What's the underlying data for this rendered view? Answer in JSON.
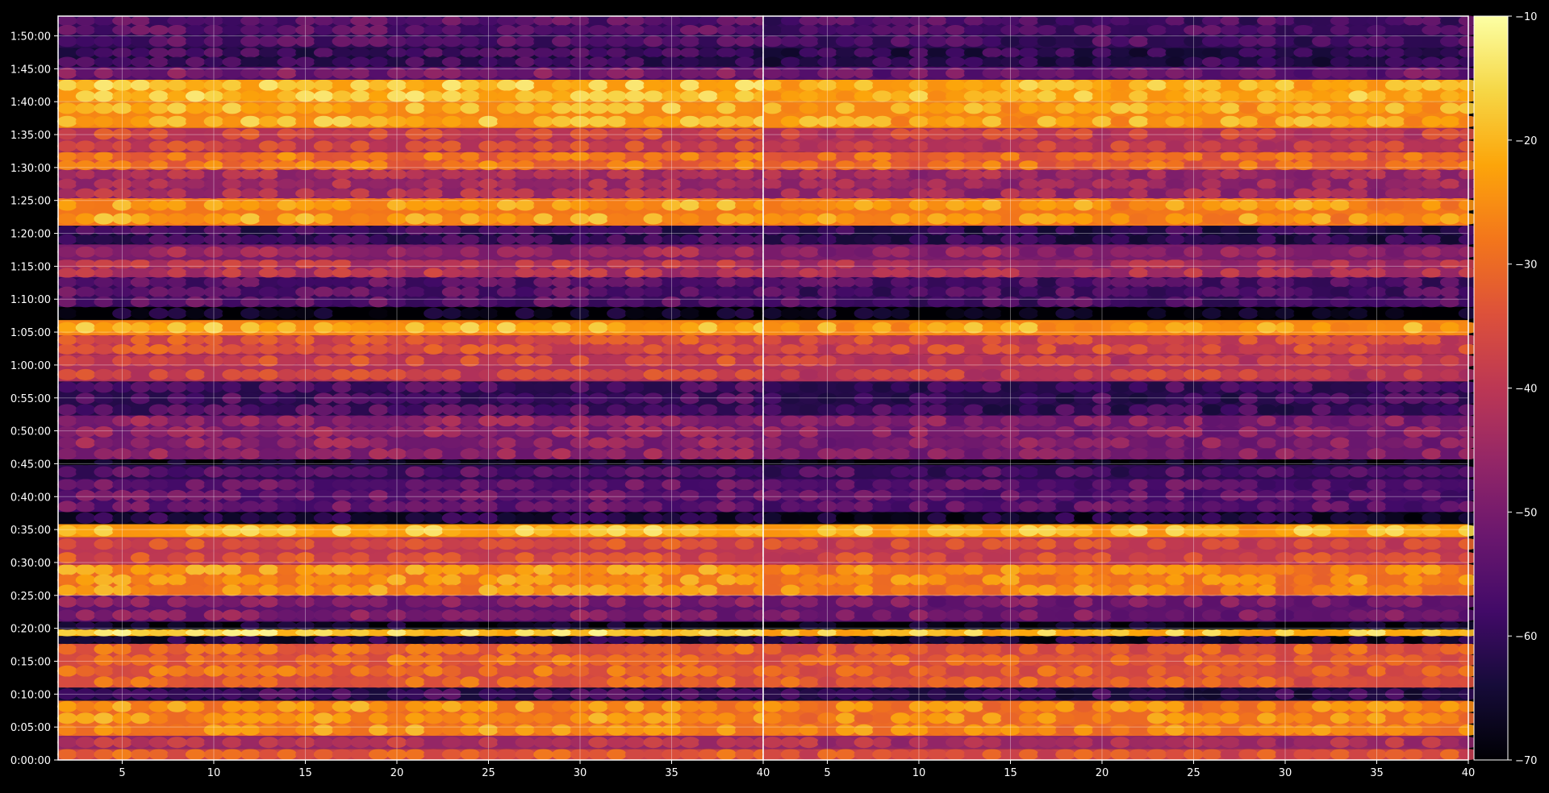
{
  "chart_data": {
    "type": "heatmap",
    "title": "",
    "xlabel": "",
    "ylabel": "",
    "panels": [
      {
        "name": "",
        "xlim": [
          1.5,
          40
        ]
      },
      {
        "name": "",
        "xlim": [
          1.5,
          40
        ]
      }
    ],
    "x_ticks": [
      5,
      10,
      15,
      20,
      25,
      30,
      35,
      40
    ],
    "x_tick_labels": [
      "5",
      "10",
      "15",
      "20",
      "25",
      "30",
      "35",
      "40"
    ],
    "y_range_seconds": [
      0,
      6780
    ],
    "y_ticks_seconds": [
      0,
      300,
      600,
      900,
      1200,
      1500,
      1800,
      2100,
      2400,
      2700,
      3000,
      3300,
      3600,
      3900,
      4200,
      4500,
      4800,
      5100,
      5400,
      5700,
      6000,
      6300,
      6600
    ],
    "y_tick_labels": [
      "0:00:00",
      "0:05:00",
      "0:10:00",
      "0:15:00",
      "0:20:00",
      "0:25:00",
      "0:30:00",
      "0:35:00",
      "0:40:00",
      "0:45:00",
      "0:50:00",
      "0:55:00",
      "1:00:00",
      "1:05:00",
      "1:10:00",
      "1:15:00",
      "1:20:00",
      "1:25:00",
      "1:30:00",
      "1:35:00",
      "1:40:00",
      "1:45:00",
      "1:50:00"
    ],
    "colorbar": {
      "colormap": "inferno",
      "range": [
        -70,
        -10
      ],
      "ticks": [
        -10,
        -20,
        -30,
        -40,
        -50,
        -60,
        -70
      ],
      "tick_labels": [
        "−10",
        "−20",
        "−30",
        "−40",
        "−50",
        "−60",
        "−70"
      ]
    },
    "grid": true,
    "row_bands": [
      {
        "y_range": [
          0,
          100
        ],
        "level": -32
      },
      {
        "y_range": [
          100,
          220
        ],
        "level": -40
      },
      {
        "y_range": [
          220,
          540
        ],
        "level": -24
      },
      {
        "y_range": [
          540,
          660
        ],
        "level": -58
      },
      {
        "y_range": [
          660,
          1060
        ],
        "level": -30
      },
      {
        "y_range": [
          1060,
          1130
        ],
        "level": -62
      },
      {
        "y_range": [
          1130,
          1190
        ],
        "level": -16
      },
      {
        "y_range": [
          1190,
          1260
        ],
        "level": -66
      },
      {
        "y_range": [
          1260,
          1500
        ],
        "level": -48
      },
      {
        "y_range": [
          1500,
          1780
        ],
        "level": -24
      },
      {
        "y_range": [
          1780,
          2030
        ],
        "level": -34
      },
      {
        "y_range": [
          2030,
          2150
        ],
        "level": -18
      },
      {
        "y_range": [
          2150,
          2260
        ],
        "level": -62
      },
      {
        "y_range": [
          2260,
          2560
        ],
        "level": -52
      },
      {
        "y_range": [
          2560,
          2690
        ],
        "level": -55
      },
      {
        "y_range": [
          2690,
          2740
        ],
        "level": -68
      },
      {
        "y_range": [
          2740,
          3140
        ],
        "level": -46
      },
      {
        "y_range": [
          3140,
          3450
        ],
        "level": -56
      },
      {
        "y_range": [
          3450,
          3700
        ],
        "level": -36
      },
      {
        "y_range": [
          3700,
          3870
        ],
        "level": -34
      },
      {
        "y_range": [
          3870,
          4010
        ],
        "level": -20
      },
      {
        "y_range": [
          4010,
          4130
        ],
        "level": -66
      },
      {
        "y_range": [
          4130,
          4400
        ],
        "level": -54
      },
      {
        "y_range": [
          4400,
          4560
        ],
        "level": -40
      },
      {
        "y_range": [
          4560,
          4700
        ],
        "level": -44
      },
      {
        "y_range": [
          4700,
          4870
        ],
        "level": -58
      },
      {
        "y_range": [
          4870,
          5120
        ],
        "level": -22
      },
      {
        "y_range": [
          5120,
          5380
        ],
        "level": -42
      },
      {
        "y_range": [
          5380,
          5540
        ],
        "level": -28
      },
      {
        "y_range": [
          5540,
          5760
        ],
        "level": -36
      },
      {
        "y_range": [
          5760,
          6000
        ],
        "level": -20
      },
      {
        "y_range": [
          6000,
          6200
        ],
        "level": -18
      },
      {
        "y_range": [
          6200,
          6320
        ],
        "level": -50
      },
      {
        "y_range": [
          6320,
          6490
        ],
        "level": -58
      },
      {
        "y_range": [
          6490,
          6610
        ],
        "level": -55
      },
      {
        "y_range": [
          6610,
          6780
        ],
        "level": -54
      }
    ]
  }
}
